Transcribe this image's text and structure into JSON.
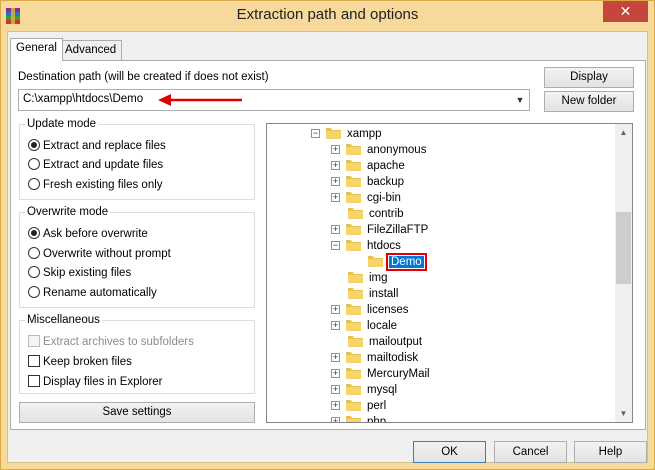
{
  "window": {
    "title": "Extraction path and options",
    "close_label": "✕",
    "icon": "winrar-app-icon"
  },
  "tabs": [
    {
      "label": "General",
      "active": true
    },
    {
      "label": "Advanced",
      "active": false
    }
  ],
  "destination": {
    "label": "Destination path (will be created if does not exist)",
    "value": "C:\\xampp\\htdocs\\Demo",
    "display_button": "Display",
    "new_folder_button": "New folder",
    "annotation_arrow_color": "#e00000"
  },
  "update_mode": {
    "title": "Update mode",
    "options": [
      {
        "label": "Extract and replace files",
        "selected": true
      },
      {
        "label": "Extract and update files",
        "selected": false
      },
      {
        "label": "Fresh existing files only",
        "selected": false
      }
    ]
  },
  "overwrite_mode": {
    "title": "Overwrite mode",
    "options": [
      {
        "label": "Ask before overwrite",
        "selected": true
      },
      {
        "label": "Overwrite without prompt",
        "selected": false
      },
      {
        "label": "Skip existing files",
        "selected": false
      },
      {
        "label": "Rename automatically",
        "selected": false
      }
    ]
  },
  "misc": {
    "title": "Miscellaneous",
    "options": [
      {
        "label": "Extract archives to subfolders",
        "checked": false,
        "disabled": true
      },
      {
        "label": "Keep broken files",
        "checked": false,
        "disabled": false
      },
      {
        "label": "Display files in Explorer",
        "checked": false,
        "disabled": false
      }
    ]
  },
  "save_settings": "Save settings",
  "tree": {
    "items": [
      {
        "label": "xampp",
        "expander": "−",
        "level": 0
      },
      {
        "label": "anonymous",
        "expander": "+",
        "level": 1
      },
      {
        "label": "apache",
        "expander": "+",
        "level": 1
      },
      {
        "label": "backup",
        "expander": "+",
        "level": 1
      },
      {
        "label": "cgi-bin",
        "expander": "+",
        "level": 1
      },
      {
        "label": "contrib",
        "expander": "",
        "level": 1
      },
      {
        "label": "FileZillaFTP",
        "expander": "+",
        "level": 1
      },
      {
        "label": "htdocs",
        "expander": "−",
        "level": 1
      },
      {
        "label": "Demo",
        "expander": "",
        "level": 2,
        "selected": true
      },
      {
        "label": "img",
        "expander": "",
        "level": 1
      },
      {
        "label": "install",
        "expander": "",
        "level": 1
      },
      {
        "label": "licenses",
        "expander": "+",
        "level": 1
      },
      {
        "label": "locale",
        "expander": "+",
        "level": 1
      },
      {
        "label": "mailoutput",
        "expander": "",
        "level": 1
      },
      {
        "label": "mailtodisk",
        "expander": "+",
        "level": 1
      },
      {
        "label": "MercuryMail",
        "expander": "+",
        "level": 1
      },
      {
        "label": "mysql",
        "expander": "+",
        "level": 1
      },
      {
        "label": "perl",
        "expander": "+",
        "level": 1
      },
      {
        "label": "php",
        "expander": "+",
        "level": 1
      }
    ],
    "folder_color": "#e8c24f"
  },
  "buttons": {
    "ok": "OK",
    "cancel": "Cancel",
    "help": "Help"
  }
}
